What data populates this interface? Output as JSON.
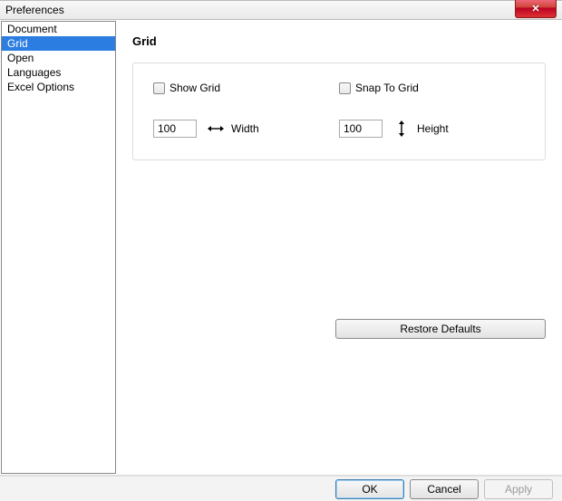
{
  "window": {
    "title": "Preferences"
  },
  "sidebar": {
    "items": [
      {
        "label": "Document"
      },
      {
        "label": "Grid"
      },
      {
        "label": "Open"
      },
      {
        "label": "Languages"
      },
      {
        "label": "Excel Options"
      }
    ],
    "selected_index": 1
  },
  "main": {
    "heading": "Grid",
    "show_grid": {
      "label": "Show Grid",
      "checked": false
    },
    "snap_to_grid": {
      "label": "Snap To Grid",
      "checked": false
    },
    "width": {
      "label": "Width",
      "value": "100"
    },
    "height": {
      "label": "Height",
      "value": "100"
    },
    "restore_label": "Restore Defaults"
  },
  "footer": {
    "ok": "OK",
    "cancel": "Cancel",
    "apply": "Apply"
  }
}
